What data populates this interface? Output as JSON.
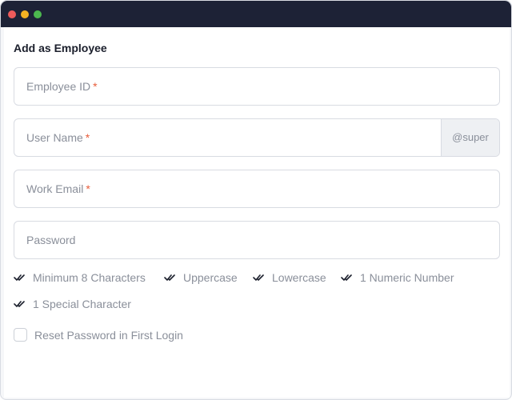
{
  "form": {
    "title": "Add as Employee",
    "employee_id": {
      "placeholder": "Employee ID",
      "required_mark": "*"
    },
    "user_name": {
      "placeholder": "User Name",
      "required_mark": "*",
      "suffix": "@super"
    },
    "work_email": {
      "placeholder": "Work Email",
      "required_mark": "*"
    },
    "password": {
      "placeholder": "Password"
    },
    "password_rules": [
      "Minimum 8 Characters",
      "Uppercase",
      "Lowercase",
      "1 Numeric Number",
      "1 Special Character"
    ],
    "reset_password": {
      "label": "Reset Password in First Login",
      "checked": false
    }
  },
  "colors": {
    "titlebar": "#1d2236",
    "required": "#e85d3b",
    "placeholder": "#8a8f9a"
  },
  "icons": {
    "rule_check": "double-check-icon"
  }
}
